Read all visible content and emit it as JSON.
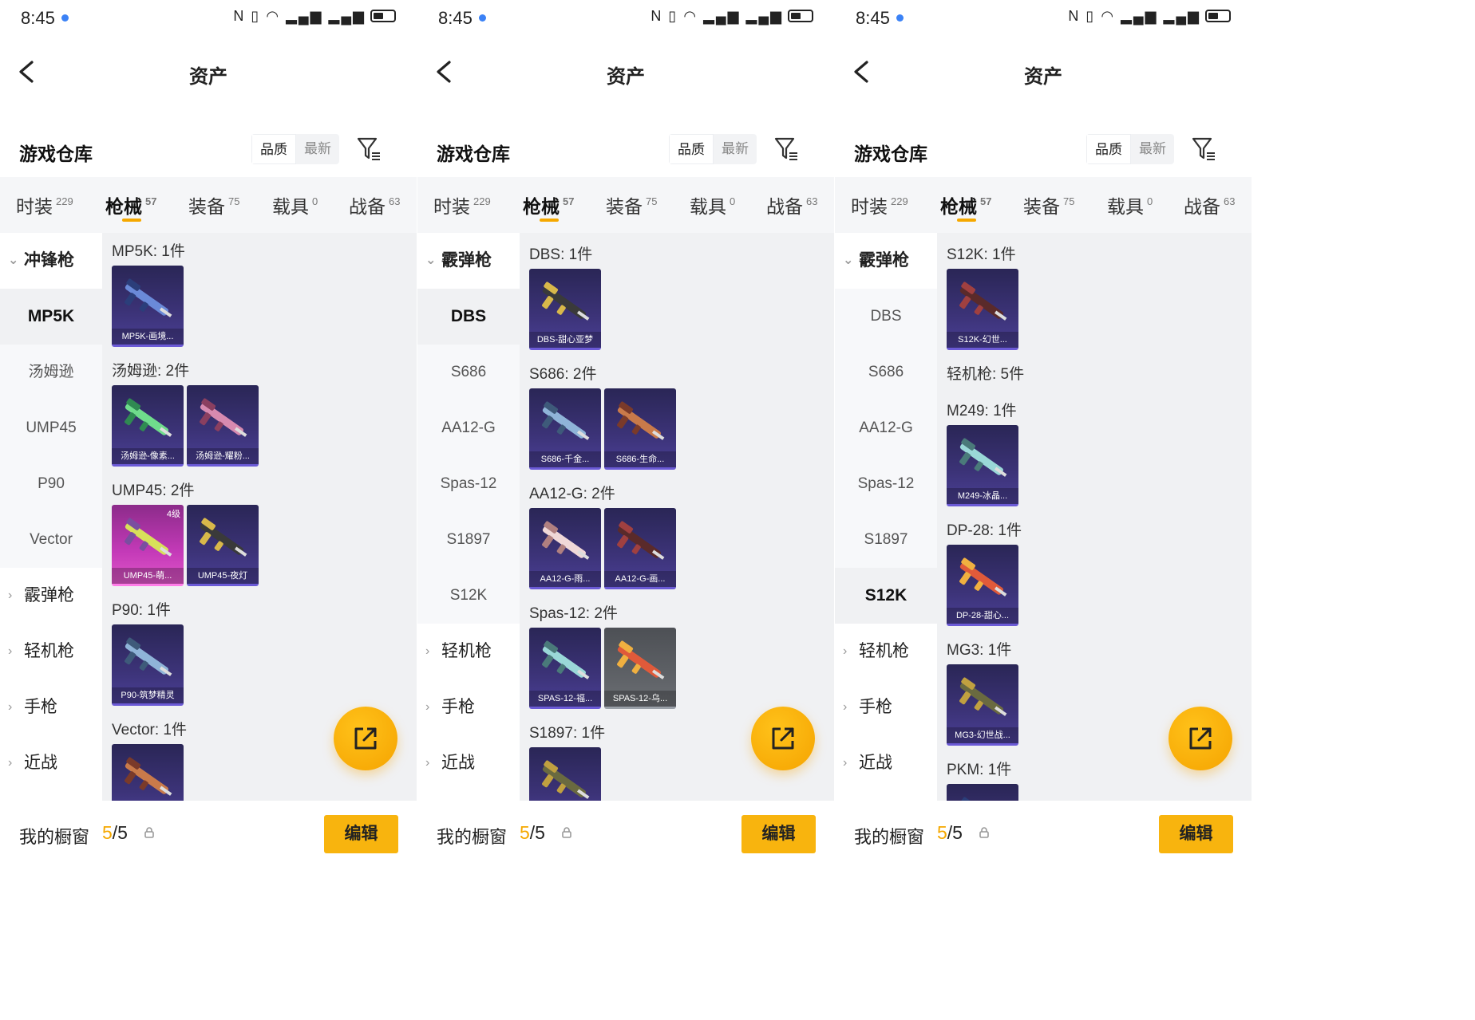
{
  "status": {
    "time": "8:45"
  },
  "header": {
    "title": "资产"
  },
  "warehouse": {
    "title": "游戏仓库",
    "sort_options": [
      "品质",
      "最新"
    ]
  },
  "tabs": [
    {
      "label": "时装",
      "count": "229"
    },
    {
      "label": "枪械",
      "count": "57"
    },
    {
      "label": "装备",
      "count": "75"
    },
    {
      "label": "载具",
      "count": "0"
    },
    {
      "label": "战备",
      "count": "63"
    }
  ],
  "showcase": {
    "label": "我的橱窗",
    "current": "5",
    "sep_total": "/5",
    "edit_label": "编辑"
  },
  "panels": [
    {
      "sidebar": {
        "open_group": "冲锋枪",
        "items": [
          "MP5K",
          "汤姆逊",
          "UMP45",
          "P90",
          "Vector"
        ],
        "groups": [
          "霰弹枪",
          "轻机枪",
          "手枪",
          "近战"
        ]
      },
      "sections": [
        {
          "label": "MP5K: 1件",
          "cards": [
            {
              "name": "MP5K-画境...",
              "style": "purple"
            }
          ]
        },
        {
          "label": "汤姆逊: 2件",
          "cards": [
            {
              "name": "汤姆逊-像素...",
              "style": "purple"
            },
            {
              "name": "汤姆逊-耀粉...",
              "style": "purple"
            }
          ]
        },
        {
          "label": "UMP45: 2件",
          "cards": [
            {
              "name": "UMP45-萌...",
              "style": "pink",
              "level": "4级"
            },
            {
              "name": "UMP45-夜灯",
              "style": "purple"
            }
          ]
        },
        {
          "label": "P90: 1件",
          "cards": [
            {
              "name": "P90-筑梦精灵",
              "style": "purple"
            }
          ]
        },
        {
          "label": "Vector: 1件",
          "cards": [
            {
              "name": "",
              "style": "purple"
            }
          ]
        }
      ]
    },
    {
      "sidebar": {
        "open_group": "霰弹枪",
        "items": [
          "DBS",
          "S686",
          "AA12-G",
          "Spas-12",
          "S1897",
          "S12K"
        ],
        "groups": [
          "轻机枪",
          "手枪",
          "近战"
        ]
      },
      "sections": [
        {
          "label": "DBS: 1件",
          "cards": [
            {
              "name": "DBS-甜心亚梦",
              "style": "purple"
            }
          ]
        },
        {
          "label": "S686: 2件",
          "cards": [
            {
              "name": "S686-千金...",
              "style": "purple"
            },
            {
              "name": "S686-生命...",
              "style": "purple"
            }
          ]
        },
        {
          "label": "AA12-G: 2件",
          "cards": [
            {
              "name": "AA12-G-雨...",
              "style": "purple"
            },
            {
              "name": "AA12-G-画...",
              "style": "purple"
            }
          ]
        },
        {
          "label": "Spas-12: 2件",
          "cards": [
            {
              "name": "SPAS-12-福...",
              "style": "purple"
            },
            {
              "name": "SPAS-12-乌...",
              "style": "gray"
            }
          ]
        },
        {
          "label": "S1897: 1件",
          "cards": [
            {
              "name": "",
              "style": "purple"
            }
          ]
        }
      ]
    },
    {
      "sidebar": {
        "open_group": "霰弹枪",
        "items": [
          "DBS",
          "S686",
          "AA12-G",
          "Spas-12",
          "S1897",
          "S12K"
        ],
        "groups": [
          "轻机枪",
          "手枪",
          "近战"
        ]
      },
      "sections": [
        {
          "label": "S12K: 1件",
          "cards": [
            {
              "name": "S12K-幻世...",
              "style": "purple"
            }
          ]
        },
        {
          "label": "轻机枪: 5件",
          "cards": []
        },
        {
          "label": "M249: 1件",
          "cards": [
            {
              "name": "M249-冰晶...",
              "style": "purple"
            }
          ]
        },
        {
          "label": "DP-28: 1件",
          "cards": [
            {
              "name": "DP-28-甜心...",
              "style": "purple"
            }
          ]
        },
        {
          "label": "MG3: 1件",
          "cards": [
            {
              "name": "MG3-幻世战...",
              "style": "purple"
            }
          ]
        },
        {
          "label": "PKM: 1件",
          "cards": [
            {
              "name": "",
              "style": "purple"
            }
          ]
        }
      ]
    }
  ]
}
